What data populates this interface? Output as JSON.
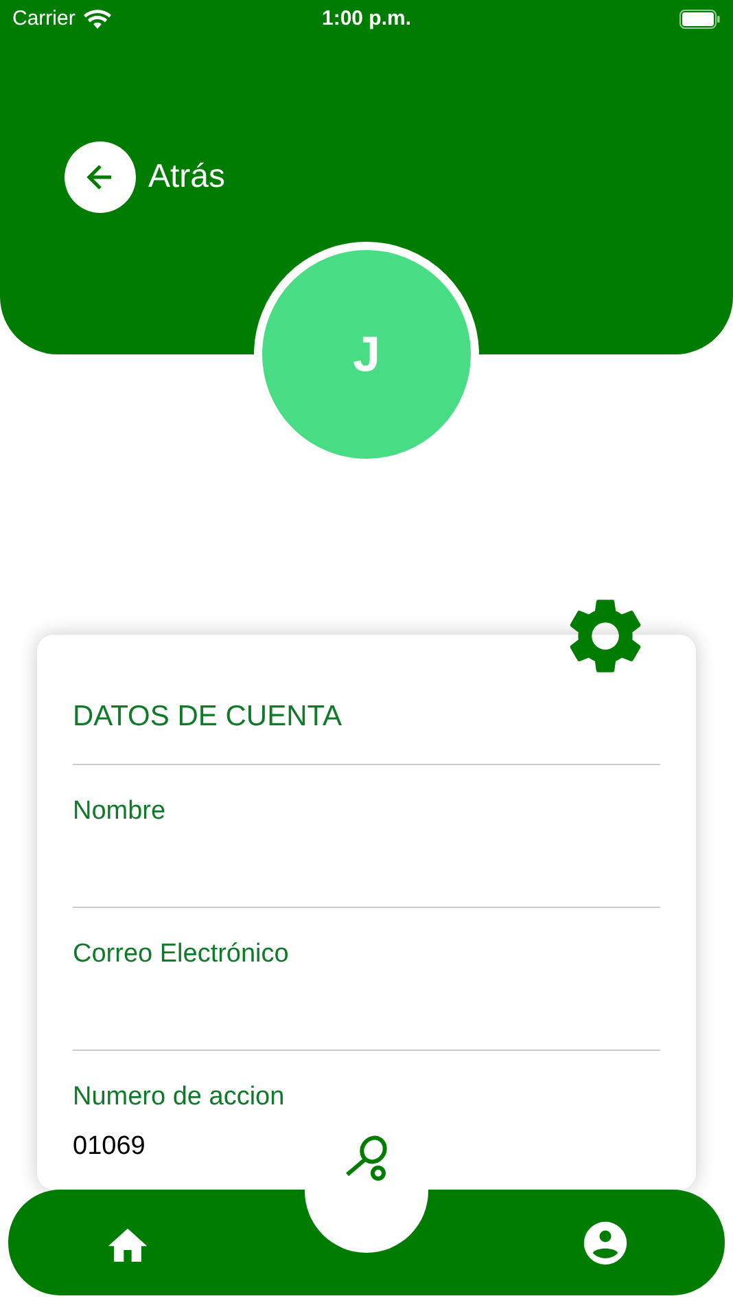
{
  "status_bar": {
    "carrier": "Carrier",
    "time": "1:00 p.m."
  },
  "header": {
    "back_label": "Atrás"
  },
  "avatar": {
    "initial": "J"
  },
  "card": {
    "title": "DATOS DE CUENTA",
    "fields": [
      {
        "label": "Nombre"
      },
      {
        "label": "Correo Electrónico"
      },
      {
        "label": "Numero de accion",
        "value": "01069"
      }
    ]
  },
  "bottom_nav": {
    "items": [
      {
        "kind": "home"
      },
      {
        "kind": "racket"
      },
      {
        "kind": "profile"
      }
    ]
  }
}
